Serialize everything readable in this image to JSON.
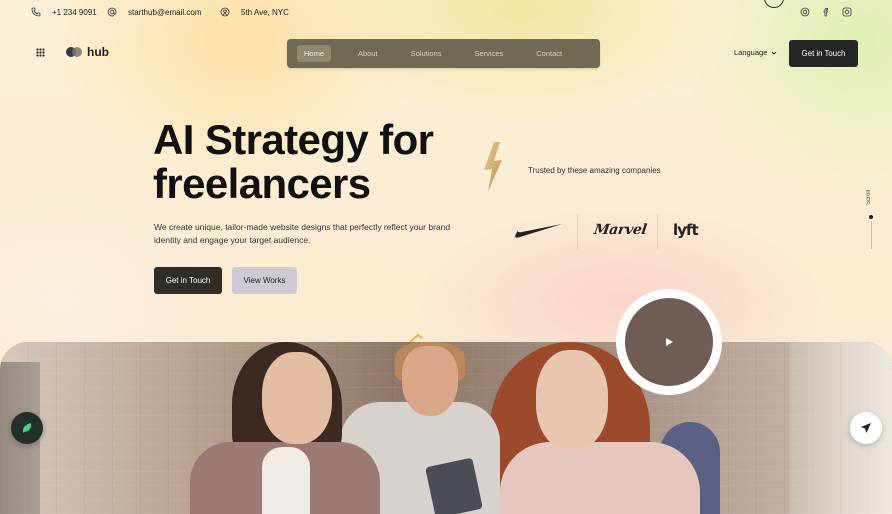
{
  "topbar": {
    "phone": "+1 234 9091",
    "email": "starthub@email.com",
    "address": "5th Ave, NYC",
    "socials": [
      "instagram-icon",
      "facebook-icon",
      "instagram-square-icon"
    ]
  },
  "header": {
    "logo_text": "hub",
    "nav": [
      {
        "label": "Home",
        "active": true
      },
      {
        "label": "About",
        "active": false
      },
      {
        "label": "Solutions",
        "active": false
      },
      {
        "label": "Services",
        "active": false
      },
      {
        "label": "Contact",
        "active": false
      }
    ],
    "language_label": "Language",
    "cta_label": "Get in Touch"
  },
  "hero": {
    "title_line1": "AI Strategy for",
    "title_line2": "freelancers",
    "subtitle": "We create unique, tailor-made website designs that perfectly reflect your brand identity and engage your target audience.",
    "primary_cta": "Get in Touch",
    "secondary_cta": "View Works"
  },
  "trusted": {
    "label": "Trusted by these amazing companies",
    "brands": [
      "Nike",
      "Marvel",
      "lyft"
    ]
  },
  "scroll": {
    "label": "Scroll"
  },
  "colors": {
    "nav_bg": "#6f6a54",
    "cta_bg": "#262626",
    "secondary_btn_bg": "#cdcad6"
  }
}
